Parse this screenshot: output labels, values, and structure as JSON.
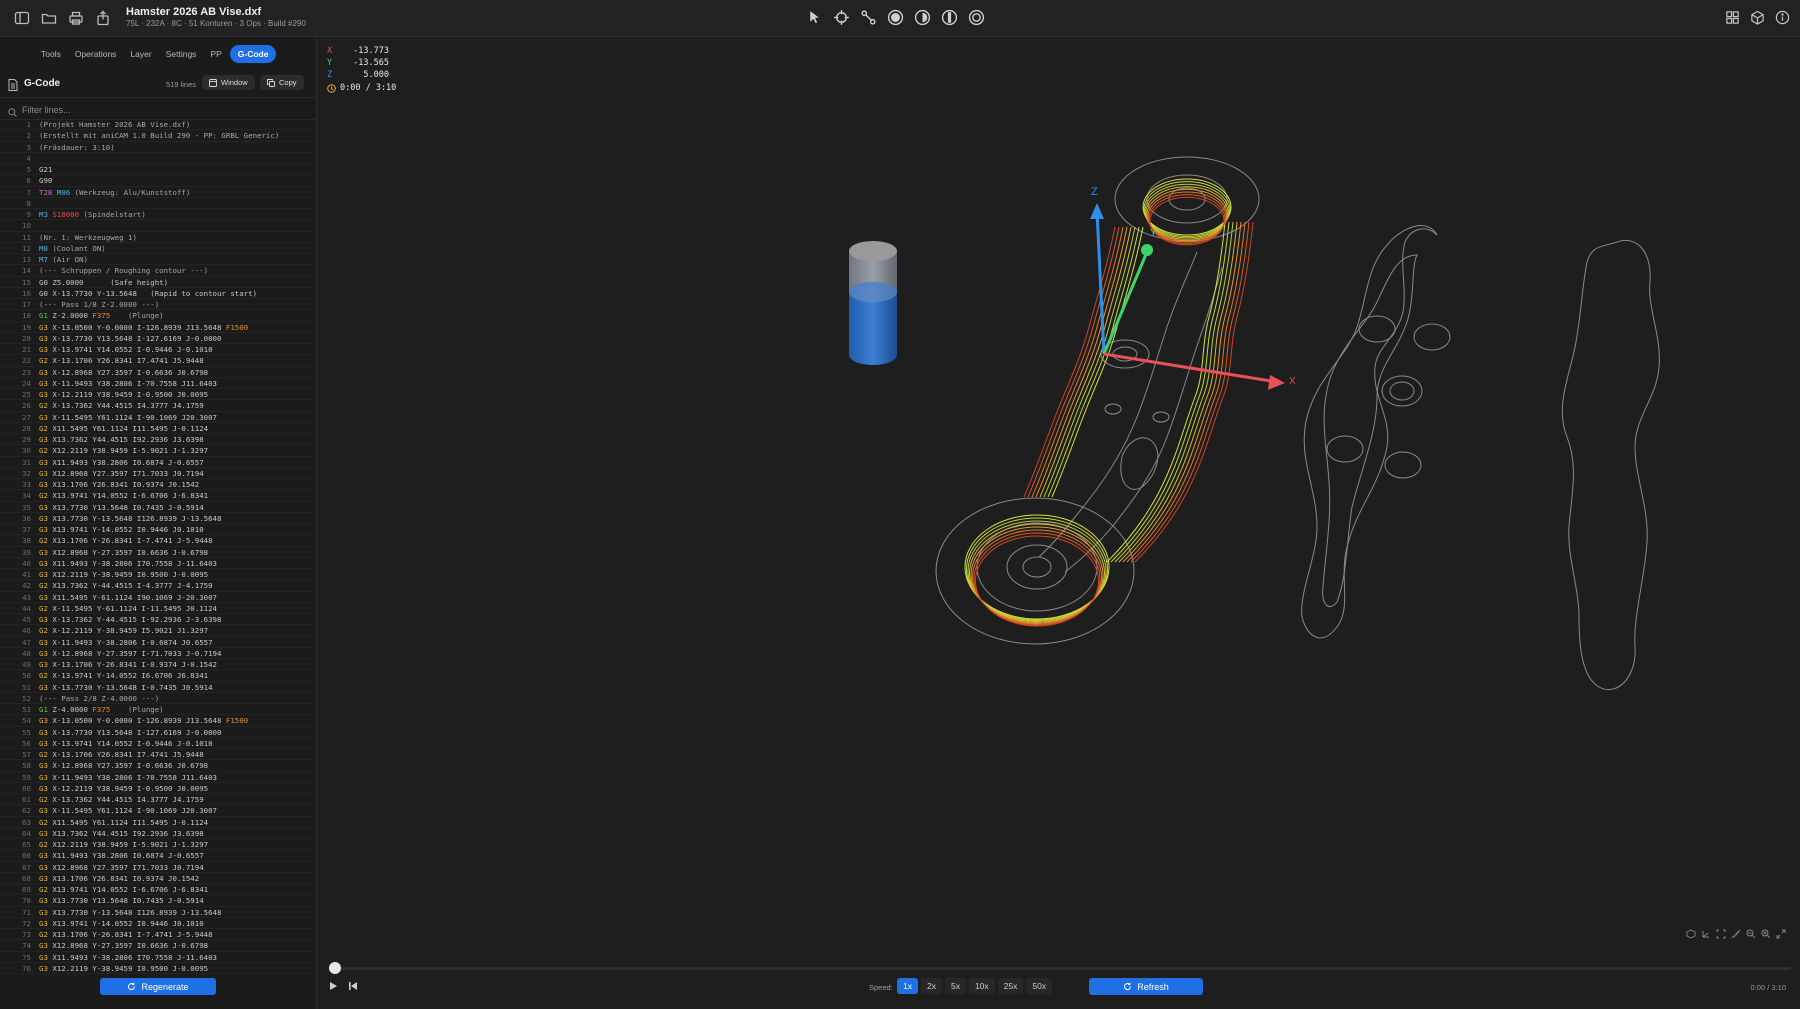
{
  "app": {
    "title": "Hamster 2026 AB Vise.dxf",
    "subtitle": "75L · 232A · 8C · 51 Konturen · 3 Ops · Build #290"
  },
  "sidebar": {
    "tabs": [
      {
        "label": "Tools",
        "active": false
      },
      {
        "label": "Operations",
        "active": false
      },
      {
        "label": "Layer",
        "active": false
      },
      {
        "label": "Settings",
        "active": false
      },
      {
        "label": "PP",
        "active": false
      },
      {
        "label": "G-Code",
        "active": true
      }
    ],
    "gcode_title": "G-Code",
    "line_count": "519 lines",
    "window_label": "Window",
    "copy_label": "Copy",
    "filter_placeholder": "Filter lines...",
    "regenerate_label": "Regenerate"
  },
  "code_lines": [
    {
      "n": "1",
      "parts": [
        {
          "t": "(Projekt Hamster 2026 AB Vise.dxf)",
          "c": "d"
        }
      ]
    },
    {
      "n": "2",
      "parts": [
        {
          "t": "(Erstellt mit aniCAM 1.0 Build 290 - PP: GRBL Generic)",
          "c": "d"
        }
      ]
    },
    {
      "n": "3",
      "parts": [
        {
          "t": "(Fräsdauer: 3:10)",
          "c": "d"
        }
      ]
    },
    {
      "n": "4",
      "parts": []
    },
    {
      "n": "5",
      "parts": [
        {
          "t": "G21",
          "c": ""
        }
      ]
    },
    {
      "n": "6",
      "parts": [
        {
          "t": "G90",
          "c": ""
        }
      ]
    },
    {
      "n": "7",
      "parts": [
        {
          "t": "T28",
          "c": "p"
        },
        {
          "t": " M06",
          "c": "c"
        },
        {
          "t": " (Werkzeug: Alu/Kunststoff)",
          "c": "d"
        }
      ]
    },
    {
      "n": "8",
      "parts": []
    },
    {
      "n": "9",
      "parts": [
        {
          "t": "M3",
          "c": "c"
        },
        {
          "t": " S18000",
          "c": "r"
        },
        {
          "t": " (Spindelstart)",
          "c": "d"
        }
      ]
    },
    {
      "n": "10",
      "parts": []
    },
    {
      "n": "11",
      "parts": [
        {
          "t": "(Nr. 1: Werkzeugweg 1)",
          "c": "d"
        }
      ]
    },
    {
      "n": "12",
      "parts": [
        {
          "t": "M8",
          "c": "c"
        },
        {
          "t": " (Coolant ON)",
          "c": "d"
        }
      ]
    },
    {
      "n": "13",
      "parts": [
        {
          "t": "M7",
          "c": "c"
        },
        {
          "t": " (Air ON)",
          "c": "d"
        }
      ]
    },
    {
      "n": "14",
      "parts": [
        {
          "t": "(--- Schruppen / Roughing contour ---)",
          "c": "d"
        }
      ]
    },
    {
      "n": "15",
      "parts": [
        {
          "t": "G0 Z5.0000      (Safe height)",
          "c": ""
        }
      ]
    },
    {
      "n": "16",
      "parts": [
        {
          "t": "G0 X-13.7730 Y-13.5648   (Rapid to contour start)",
          "c": ""
        }
      ]
    },
    {
      "n": "17",
      "parts": [
        {
          "t": "(--- Pass 1/8 Z-2.0000 ---)",
          "c": "d"
        }
      ]
    },
    {
      "n": "18",
      "parts": [
        {
          "t": "G1",
          "c": "g"
        },
        {
          "t": " Z-2.0000 ",
          "c": ""
        },
        {
          "t": "F375",
          "c": "o"
        },
        {
          "t": "    (Plunge)",
          "c": "d"
        }
      ]
    },
    {
      "n": "19",
      "parts": [
        {
          "t": "G3",
          "c": "y"
        },
        {
          "t": " X-13.0500 Y-0.0000 I-126.8939 J13.5648 ",
          "c": ""
        },
        {
          "t": "F1500",
          "c": "o"
        }
      ]
    },
    {
      "n": "20",
      "parts": [
        {
          "t": "G3",
          "c": "y"
        },
        {
          "t": " X-13.7730 Y13.5648 I-127.6169 J-0.0000",
          "c": ""
        }
      ]
    },
    {
      "n": "21",
      "parts": [
        {
          "t": "G3",
          "c": "y"
        },
        {
          "t": " X-13.9741 Y14.0552 I-0.9446 J-0.1010",
          "c": ""
        }
      ]
    },
    {
      "n": "22",
      "parts": [
        {
          "t": "G2",
          "c": "y"
        },
        {
          "t": " X-13.1706 Y26.8341 I7.4741 J5.9448",
          "c": ""
        }
      ]
    },
    {
      "n": "23",
      "parts": [
        {
          "t": "G3",
          "c": "y"
        },
        {
          "t": " X-12.8968 Y27.3597 I-0.6636 J0.6798",
          "c": ""
        }
      ]
    },
    {
      "n": "24",
      "parts": [
        {
          "t": "G3",
          "c": "y"
        },
        {
          "t": " X-11.9493 Y38.2806 I-70.7558 J11.6403",
          "c": ""
        }
      ]
    },
    {
      "n": "25",
      "parts": [
        {
          "t": "G3",
          "c": "y"
        },
        {
          "t": " X-12.2119 Y38.9459 I-0.9500 J0.0095",
          "c": ""
        }
      ]
    },
    {
      "n": "26",
      "parts": [
        {
          "t": "G2",
          "c": "y"
        },
        {
          "t": " X-13.7362 Y44.4515 I4.3777 J4.1759",
          "c": ""
        }
      ]
    },
    {
      "n": "27",
      "parts": [
        {
          "t": "G3",
          "c": "y"
        },
        {
          "t": " X-11.5495 Y61.1124 I-90.1069 J20.3007",
          "c": ""
        }
      ]
    },
    {
      "n": "28",
      "parts": [
        {
          "t": "G2",
          "c": "y"
        },
        {
          "t": " X11.5495 Y61.1124 I11.5495 J-0.1124",
          "c": ""
        }
      ]
    },
    {
      "n": "29",
      "parts": [
        {
          "t": "G3",
          "c": "y"
        },
        {
          "t": " X13.7362 Y44.4515 I92.2936 J3.6398",
          "c": ""
        }
      ]
    },
    {
      "n": "30",
      "parts": [
        {
          "t": "G2",
          "c": "y"
        },
        {
          "t": " X12.2119 Y38.9459 I-5.9021 J-1.3297",
          "c": ""
        }
      ]
    },
    {
      "n": "31",
      "parts": [
        {
          "t": "G3",
          "c": "y"
        },
        {
          "t": " X11.9493 Y38.2806 I0.6874 J-0.6557",
          "c": ""
        }
      ]
    },
    {
      "n": "32",
      "parts": [
        {
          "t": "G3",
          "c": "y"
        },
        {
          "t": " X12.8968 Y27.3597 I71.7033 J0.7194",
          "c": ""
        }
      ]
    },
    {
      "n": "33",
      "parts": [
        {
          "t": "G3",
          "c": "y"
        },
        {
          "t": " X13.1706 Y26.8341 I0.9374 J0.1542",
          "c": ""
        }
      ]
    },
    {
      "n": "34",
      "parts": [
        {
          "t": "G2",
          "c": "y"
        },
        {
          "t": " X13.9741 Y14.0552 I-6.6706 J-6.8341",
          "c": ""
        }
      ]
    },
    {
      "n": "35",
      "parts": [
        {
          "t": "G3",
          "c": "y"
        },
        {
          "t": " X13.7730 Y13.5648 I0.7435 J-0.5914",
          "c": ""
        }
      ]
    },
    {
      "n": "36",
      "parts": [
        {
          "t": "G3",
          "c": "y"
        },
        {
          "t": " X13.7730 Y-13.5648 I126.8939 J-13.5648",
          "c": ""
        }
      ]
    },
    {
      "n": "37",
      "parts": [
        {
          "t": "G3",
          "c": "y"
        },
        {
          "t": " X13.9741 Y-14.0552 I0.9446 J0.1010",
          "c": ""
        }
      ]
    },
    {
      "n": "38",
      "parts": [
        {
          "t": "G2",
          "c": "y"
        },
        {
          "t": " X13.1706 Y-26.8341 I-7.4741 J-5.9448",
          "c": ""
        }
      ]
    },
    {
      "n": "39",
      "parts": [
        {
          "t": "G3",
          "c": "y"
        },
        {
          "t": " X12.8968 Y-27.3597 I0.6636 J-0.6798",
          "c": ""
        }
      ]
    },
    {
      "n": "40",
      "parts": [
        {
          "t": "G3",
          "c": "y"
        },
        {
          "t": " X11.9493 Y-38.2806 I70.7558 J-11.6403",
          "c": ""
        }
      ]
    },
    {
      "n": "41",
      "parts": [
        {
          "t": "G3",
          "c": "y"
        },
        {
          "t": " X12.2119 Y-38.9459 I0.9500 J-0.0095",
          "c": ""
        }
      ]
    },
    {
      "n": "42",
      "parts": [
        {
          "t": "G2",
          "c": "y"
        },
        {
          "t": " X13.7362 Y-44.4515 I-4.3777 J-4.1759",
          "c": ""
        }
      ]
    },
    {
      "n": "43",
      "parts": [
        {
          "t": "G3",
          "c": "y"
        },
        {
          "t": " X11.5495 Y-61.1124 I90.1069 J-20.3007",
          "c": ""
        }
      ]
    },
    {
      "n": "44",
      "parts": [
        {
          "t": "G2",
          "c": "y"
        },
        {
          "t": " X-11.5495 Y-61.1124 I-11.5495 J0.1124",
          "c": ""
        }
      ]
    },
    {
      "n": "45",
      "parts": [
        {
          "t": "G3",
          "c": "y"
        },
        {
          "t": " X-13.7362 Y-44.4515 I-92.2936 J-3.6398",
          "c": ""
        }
      ]
    },
    {
      "n": "46",
      "parts": [
        {
          "t": "G2",
          "c": "y"
        },
        {
          "t": " X-12.2119 Y-38.9459 I5.9021 J1.3297",
          "c": ""
        }
      ]
    },
    {
      "n": "47",
      "parts": [
        {
          "t": "G3",
          "c": "y"
        },
        {
          "t": " X-11.9493 Y-38.2806 I-0.6874 J0.6557",
          "c": ""
        }
      ]
    },
    {
      "n": "48",
      "parts": [
        {
          "t": "G3",
          "c": "y"
        },
        {
          "t": " X-12.8968 Y-27.3597 I-71.7033 J-0.7194",
          "c": ""
        }
      ]
    },
    {
      "n": "49",
      "parts": [
        {
          "t": "G3",
          "c": "y"
        },
        {
          "t": " X-13.1706 Y-26.8341 I-0.9374 J-0.1542",
          "c": ""
        }
      ]
    },
    {
      "n": "50",
      "parts": [
        {
          "t": "G2",
          "c": "y"
        },
        {
          "t": " X-13.9741 Y-14.0552 I6.6706 J6.8341",
          "c": ""
        }
      ]
    },
    {
      "n": "51",
      "parts": [
        {
          "t": "G3",
          "c": "y"
        },
        {
          "t": " X-13.7730 Y-13.5648 I-0.7435 J0.5914",
          "c": ""
        }
      ]
    },
    {
      "n": "52",
      "parts": [
        {
          "t": "(--- Pass 2/8 Z-4.0000 ---)",
          "c": "d"
        }
      ]
    },
    {
      "n": "53",
      "parts": [
        {
          "t": "G1",
          "c": "g"
        },
        {
          "t": " Z-4.0000 ",
          "c": ""
        },
        {
          "t": "F375",
          "c": "o"
        },
        {
          "t": "    (Plunge)",
          "c": "d"
        }
      ]
    },
    {
      "n": "54",
      "parts": [
        {
          "t": "G3",
          "c": "y"
        },
        {
          "t": " X-13.0500 Y-0.0000 I-126.8939 J13.5648 ",
          "c": ""
        },
        {
          "t": "F1500",
          "c": "o"
        }
      ]
    },
    {
      "n": "55",
      "parts": [
        {
          "t": "G3",
          "c": "y"
        },
        {
          "t": " X-13.7730 Y13.5648 I-127.6169 J-0.0000",
          "c": ""
        }
      ]
    },
    {
      "n": "56",
      "parts": [
        {
          "t": "G3",
          "c": "y"
        },
        {
          "t": " X-13.9741 Y14.0552 I-0.9446 J-0.1010",
          "c": ""
        }
      ]
    },
    {
      "n": "57",
      "parts": [
        {
          "t": "G2",
          "c": "y"
        },
        {
          "t": " X-13.1706 Y26.8341 I7.4741 J5.9448",
          "c": ""
        }
      ]
    },
    {
      "n": "58",
      "parts": [
        {
          "t": "G3",
          "c": "y"
        },
        {
          "t": " X-12.8968 Y27.3597 I-0.6636 J0.6798",
          "c": ""
        }
      ]
    },
    {
      "n": "59",
      "parts": [
        {
          "t": "G3",
          "c": "y"
        },
        {
          "t": " X-11.9493 Y38.2806 I-70.7558 J11.6403",
          "c": ""
        }
      ]
    },
    {
      "n": "60",
      "parts": [
        {
          "t": "G3",
          "c": "y"
        },
        {
          "t": " X-12.2119 Y38.9459 I-0.9500 J0.0095",
          "c": ""
        }
      ]
    },
    {
      "n": "61",
      "parts": [
        {
          "t": "G2",
          "c": "y"
        },
        {
          "t": " X-13.7362 Y44.4515 I4.3777 J4.1759",
          "c": ""
        }
      ]
    },
    {
      "n": "62",
      "parts": [
        {
          "t": "G3",
          "c": "y"
        },
        {
          "t": " X-11.5495 Y61.1124 I-90.1069 J20.3007",
          "c": ""
        }
      ]
    },
    {
      "n": "63",
      "parts": [
        {
          "t": "G2",
          "c": "y"
        },
        {
          "t": " X11.5495 Y61.1124 I11.5495 J-0.1124",
          "c": ""
        }
      ]
    },
    {
      "n": "64",
      "parts": [
        {
          "t": "G3",
          "c": "y"
        },
        {
          "t": " X13.7362 Y44.4515 I92.2936 J3.6398",
          "c": ""
        }
      ]
    },
    {
      "n": "65",
      "parts": [
        {
          "t": "G2",
          "c": "y"
        },
        {
          "t": " X12.2119 Y38.9459 I-5.9021 J-1.3297",
          "c": ""
        }
      ]
    },
    {
      "n": "66",
      "parts": [
        {
          "t": "G3",
          "c": "y"
        },
        {
          "t": " X11.9493 Y38.2806 I0.6874 J-0.6557",
          "c": ""
        }
      ]
    },
    {
      "n": "67",
      "parts": [
        {
          "t": "G3",
          "c": "y"
        },
        {
          "t": " X12.8968 Y27.3597 I71.7033 J0.7194",
          "c": ""
        }
      ]
    },
    {
      "n": "68",
      "parts": [
        {
          "t": "G3",
          "c": "y"
        },
        {
          "t": " X13.1706 Y26.8341 I0.9374 J0.1542",
          "c": ""
        }
      ]
    },
    {
      "n": "69",
      "parts": [
        {
          "t": "G2",
          "c": "y"
        },
        {
          "t": " X13.9741 Y14.0552 I-6.6706 J-6.8341",
          "c": ""
        }
      ]
    },
    {
      "n": "70",
      "parts": [
        {
          "t": "G3",
          "c": "y"
        },
        {
          "t": " X13.7730 Y13.5648 I0.7435 J-0.5914",
          "c": ""
        }
      ]
    },
    {
      "n": "71",
      "parts": [
        {
          "t": "G3",
          "c": "y"
        },
        {
          "t": " X13.7730 Y-13.5648 I126.8939 J-13.5648",
          "c": ""
        }
      ]
    },
    {
      "n": "72",
      "parts": [
        {
          "t": "G3",
          "c": "y"
        },
        {
          "t": " X13.9741 Y-14.0552 I0.9446 J0.1010",
          "c": ""
        }
      ]
    },
    {
      "n": "73",
      "parts": [
        {
          "t": "G2",
          "c": "y"
        },
        {
          "t": " X13.1706 Y-26.8341 I-7.4741 J-5.9448",
          "c": ""
        }
      ]
    },
    {
      "n": "74",
      "parts": [
        {
          "t": "G3",
          "c": "y"
        },
        {
          "t": " X12.8968 Y-27.3597 I0.6636 J-0.6798",
          "c": ""
        }
      ]
    },
    {
      "n": "75",
      "parts": [
        {
          "t": "G3",
          "c": "y"
        },
        {
          "t": " X11.9493 Y-38.2806 I70.7558 J-11.6403",
          "c": ""
        }
      ]
    },
    {
      "n": "76",
      "parts": [
        {
          "t": "G3",
          "c": "y"
        },
        {
          "t": " X12.2119 Y-38.9459 I0.9500 J-0.0095",
          "c": ""
        }
      ]
    }
  ],
  "viewport": {
    "coords": {
      "x_label": "X",
      "x": "-13.773",
      "y_label": "Y",
      "y": "-13.565",
      "z_label": "Z",
      "z": "5.000",
      "time": "0:00 / 3:10"
    },
    "axis_labels": {
      "x": "X",
      "y": "Y",
      "z": "Z"
    },
    "playback_position": 0.0,
    "speed_label": "Speed:",
    "speeds": [
      {
        "label": "1x",
        "active": true
      },
      {
        "label": "2x",
        "active": false
      },
      {
        "label": "5x",
        "active": false
      },
      {
        "label": "10x",
        "active": false
      },
      {
        "label": "25x",
        "active": false
      },
      {
        "label": "50x",
        "active": false
      }
    ],
    "refresh_label": "Refresh",
    "time_right": "0:00 / 3:10"
  },
  "colors": {
    "accent": "#1f6fe5",
    "axis_x": "#e8505a",
    "axis_y": "#3fd46a",
    "axis_z": "#2e8fe8",
    "gcode_arc": "#e7b421",
    "gcode_linear": "#5fc25f",
    "gcode_m": "#48b5e0",
    "gcode_tool": "#cf66d8",
    "gcode_feed": "#e68c2e",
    "gcode_spindle": "#e0504a"
  }
}
